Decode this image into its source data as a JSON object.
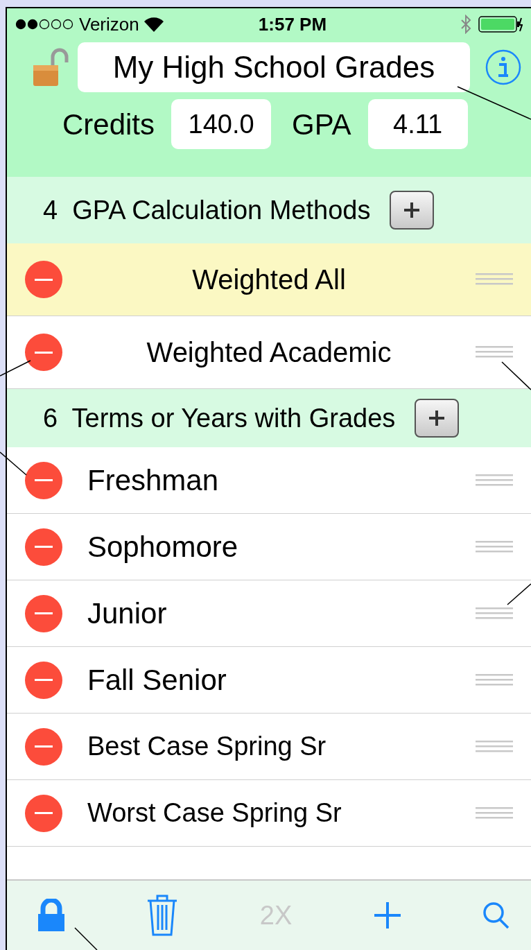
{
  "status_bar": {
    "carrier": "Verizon",
    "time": "1:57 PM"
  },
  "header": {
    "title": "My High School Grades",
    "locked": false,
    "credits_label": "Credits",
    "credits": "140.0",
    "gpa_label": "GPA",
    "gpa": "4.11"
  },
  "sections": [
    {
      "count": "4",
      "title": "GPA Calculation Methods",
      "kind": "methods",
      "items": [
        {
          "label": "Weighted All",
          "selected": true
        },
        {
          "label": "Weighted Academic",
          "selected": false
        }
      ]
    },
    {
      "count": "6",
      "title": "Terms or Years with Grades",
      "kind": "terms",
      "items": [
        {
          "label": "Freshman",
          "selected": false
        },
        {
          "label": "Sophomore",
          "selected": false
        },
        {
          "label": "Junior",
          "selected": false
        },
        {
          "label": "Fall Senior",
          "selected": false
        },
        {
          "label": "Best Case Spring Sr",
          "selected": false
        },
        {
          "label": "Worst Case Spring Sr",
          "selected": false
        }
      ]
    }
  ],
  "toolbar": [
    {
      "kind": "lock",
      "disabled": false
    },
    {
      "kind": "trash",
      "disabled": false
    },
    {
      "kind": "text",
      "label": "2X",
      "disabled": true
    },
    {
      "kind": "plus",
      "disabled": false
    },
    {
      "kind": "search",
      "disabled": false
    }
  ]
}
